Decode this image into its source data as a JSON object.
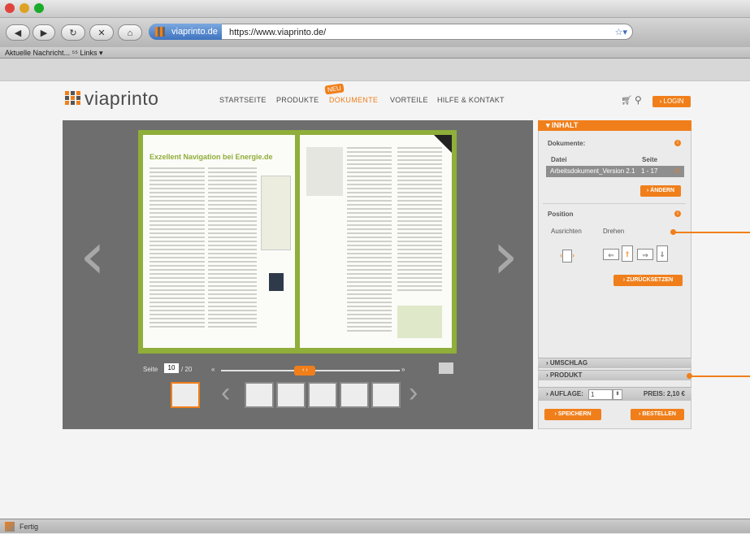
{
  "browser": {
    "site_chip": "viaprinto.de",
    "url": "https://www.viaprinto.de/",
    "bookmarks": "Aktuelle Nachricht... ⁵⁵  Links ▾",
    "status": "Fertig",
    "star": "☆▾"
  },
  "site": {
    "logo": "viaprinto",
    "nav": {
      "startseite": "STARTSEITE",
      "produkte": "PRODUKTE",
      "dokumente": "DOKUMENTE",
      "vorteile": "VORTEILE",
      "hilfe": "HILFE & KONTAKT",
      "neu_badge": "NEU"
    },
    "login": "› LOGIN"
  },
  "viewer": {
    "document_title": "Exzellent Navigation bei Energie.de",
    "page_label": "Seite",
    "page_current": "10",
    "page_total": "/ 20",
    "progress": 0.47
  },
  "panel": {
    "inhalt_header": "▾ INHALT",
    "dokumente_label": "Dokumente:",
    "col_datei": "Datei",
    "col_seite": "Seite",
    "file_name": "Arbeitsdokument_Version 2.1",
    "file_pages": "1 - 17",
    "aendern": "› ÄNDERN",
    "position_label": "Position",
    "ausrichten_label": "Ausrichten",
    "drehen_label": "Drehen",
    "zuruecksetzen": "› ZURÜCKSETZEN",
    "umschlag": "› UMSCHLAG",
    "produkt": "› PRODUKT",
    "auflage_label": "› AUFLAGE:",
    "auflage_value": "1",
    "preis": "PREIS: 2,10 €",
    "speichern": "› SPEICHERN",
    "bestellen": "› BESTELLEN"
  }
}
